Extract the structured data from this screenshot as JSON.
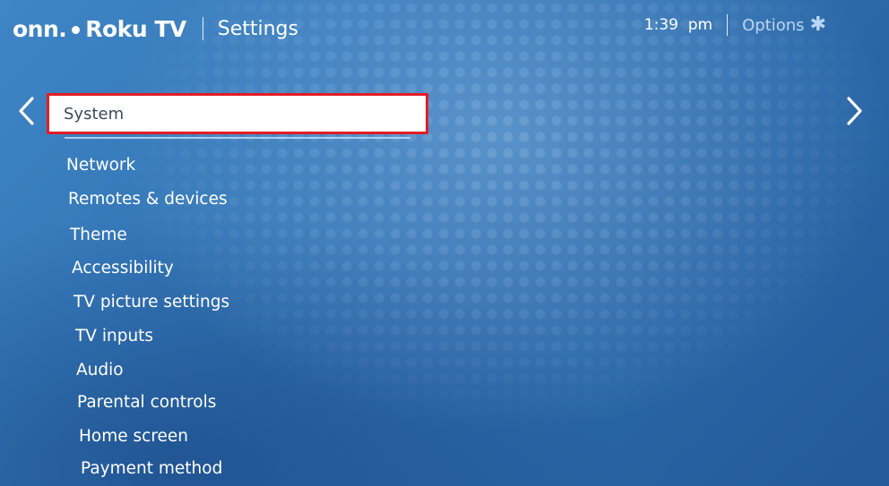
{
  "header": {
    "brand_onn": "onn.",
    "brand_roku": "Roku TV",
    "title": "Settings"
  },
  "topbar": {
    "time": "1:39  pm",
    "options_label": "Options",
    "options_icon": "asterisk-icon"
  },
  "menu": {
    "selected": "System",
    "items": [
      "Network",
      "Remotes & devices",
      "Theme",
      "Accessibility",
      "TV picture settings",
      "TV inputs",
      "Audio",
      "Parental controls",
      "Home screen",
      "Payment method"
    ]
  },
  "colors": {
    "background": "#2f6fb0",
    "highlight_border": "#e21d25",
    "options_text": "#b9d6f3"
  }
}
